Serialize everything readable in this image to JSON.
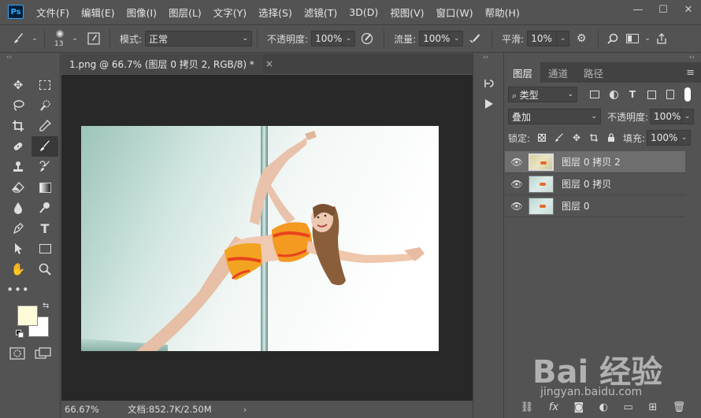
{
  "app": {
    "logo": "Ps"
  },
  "menu": [
    "文件(F)",
    "编辑(E)",
    "图像(I)",
    "图层(L)",
    "文字(Y)",
    "选择(S)",
    "滤镜(T)",
    "3D(D)",
    "视图(V)",
    "窗口(W)",
    "帮助(H)"
  ],
  "window_controls": {
    "minimize": "—",
    "maximize": "☐",
    "close": "✕"
  },
  "options": {
    "brush_size": "13",
    "mode_label": "模式:",
    "mode_value": "正常",
    "opacity_label": "不透明度:",
    "opacity_value": "100%",
    "flow_label": "流量:",
    "flow_value": "100%",
    "smooth_label": "平滑:",
    "smooth_value": "10%"
  },
  "document": {
    "tab_title": "1.png @ 66.7% (图层 0 拷贝 2, RGB/8) *",
    "close": "×",
    "zoom": "66.67%",
    "doc_info": "文档:852.7K/2.50M",
    "status_arrow": "›"
  },
  "colors": {
    "foreground": "#fefbdb",
    "background": "#ffffff"
  },
  "layers_panel": {
    "tabs": [
      "图层",
      "通道",
      "路径"
    ],
    "filter_label": "类型",
    "blend_mode": "叠加",
    "opacity_label": "不透明度:",
    "opacity_value": "100%",
    "lock_label": "锁定:",
    "fill_label": "填充:",
    "fill_value": "100%",
    "layers": [
      {
        "name": "图层 0 拷贝 2",
        "selected": true
      },
      {
        "name": "图层 0 拷贝",
        "selected": false
      },
      {
        "name": "图层 0",
        "selected": false
      }
    ]
  },
  "watermark": {
    "brand": "Bai 经验",
    "url": "jingyan.baidu.com"
  }
}
